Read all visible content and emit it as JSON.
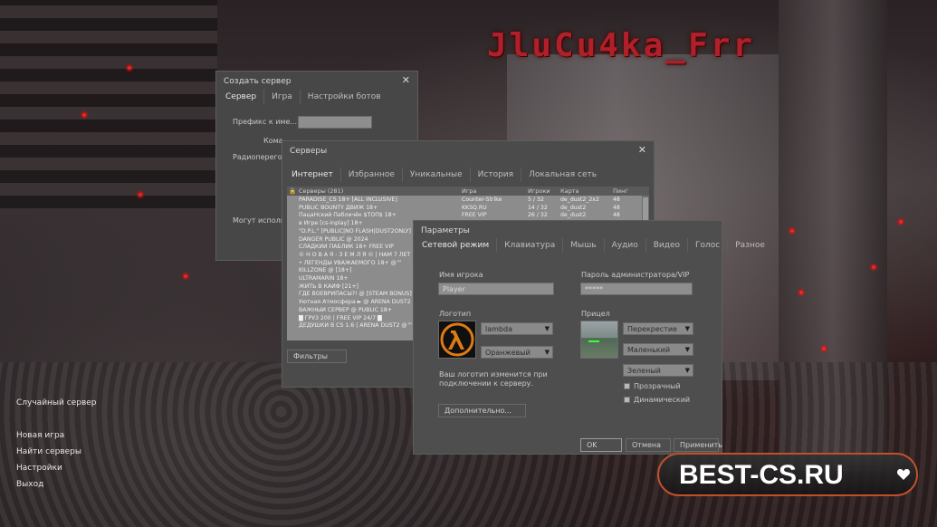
{
  "logo": {
    "text": "JluCu4ka_Frr"
  },
  "watermark": {
    "text": "BEST-CS.RU"
  },
  "menu": {
    "random_server": "Случайный сервер",
    "new_game": "Новая игра",
    "find_servers": "Найти серверы",
    "settings": "Настройки",
    "exit": "Выход"
  },
  "create_server": {
    "title": "Создать сервер",
    "tabs": [
      "Сервер",
      "Игра",
      "Настройки ботов"
    ],
    "prefix_label": "Префикс к име...",
    "team_label": "Кома...",
    "radio_label": "Радиопереговс...",
    "can_use_label": "Могут исполь..."
  },
  "servers": {
    "title": "Серверы",
    "tabs": [
      "Интернет",
      "Избранное",
      "Уникальные",
      "История",
      "Локальная сеть"
    ],
    "columns": [
      "Серверы (281)",
      "Игра",
      "Игроки",
      "Карта",
      "Пинг"
    ],
    "rows": [
      {
        "name": "PARADISE_CS 18+ [ALL INCLUSIVE]",
        "game": "Counter-Strike",
        "players": "5 / 32",
        "map": "de_dust2_2x2",
        "ping": "48"
      },
      {
        "name": "PUBLIC BOUNTY ДВИЖ 18+",
        "game": "KKSQ.RU",
        "players": "14 / 32",
        "map": "de_dust2",
        "ping": "48"
      },
      {
        "name": "ПацаНский Пабличёк $TOП$ 18+",
        "game": "FREE VIP",
        "players": "26 / 32",
        "map": "de_dust2",
        "ping": "48"
      },
      {
        "name": "в Игре [cs-inplay] 18+",
        "game": "",
        "players": "",
        "map": "",
        "ping": ""
      },
      {
        "name": "\"D.P.L.\" [PUBLIC|NO FLASH|DUST2ONLY]",
        "game": "",
        "players": "",
        "map": "",
        "ping": ""
      },
      {
        "name": "DANGER PUBLIC @ 2024",
        "game": "",
        "players": "",
        "map": "",
        "ping": ""
      },
      {
        "name": "СЛАДКИЙ ПАБЛИК 18+ FREE VIP",
        "game": "",
        "players": "",
        "map": "",
        "ping": ""
      },
      {
        "name": "© Н О В А Я - З Е М Л Я © | НАМ 7 ЛЕТ",
        "game": "",
        "players": "",
        "map": "",
        "ping": ""
      },
      {
        "name": "• ЛЕГЕНДЫ УВАЖАЕМОГО 18+ @™",
        "game": "",
        "players": "",
        "map": "",
        "ping": ""
      },
      {
        "name": "KILLZONE @ [18+]",
        "game": "",
        "players": "",
        "map": "",
        "ping": ""
      },
      {
        "name": "ULTRAMARIN 18+",
        "game": "",
        "players": "",
        "map": "",
        "ping": ""
      },
      {
        "name": "ЖИТЬ В КАЙФ [21+]",
        "game": "",
        "players": "",
        "map": "",
        "ping": ""
      },
      {
        "name": "ГДЕ ВОЕВРИПАСЫ?! @ [STEAM BONUS]",
        "game": "",
        "players": "",
        "map": "",
        "ping": ""
      },
      {
        "name": "Уютная Атмосфера ► @ ARENA DUST2",
        "game": "",
        "players": "",
        "map": "",
        "ping": ""
      },
      {
        "name": "ВАЖНЫЙ СЕРВЕР @ PUBLIC 18+",
        "game": "",
        "players": "",
        "map": "",
        "ping": ""
      },
      {
        "name": "█ ГРУЗ 200 | FREE VIP 24/7 █",
        "game": "",
        "players": "",
        "map": "",
        "ping": ""
      },
      {
        "name": "ДЕДУШКИ В CS 1.6 | ARENA DUST2 @™",
        "game": "",
        "players": "",
        "map": "",
        "ping": ""
      }
    ],
    "filters_button": "Фильтры"
  },
  "params": {
    "title": "Параметры",
    "tabs": [
      "Сетевой режим",
      "Клавиатура",
      "Мышь",
      "Аудио",
      "Видео",
      "Голос",
      "Разное"
    ],
    "player_name_label": "Имя игрока",
    "player_name_value": "Player",
    "admin_pass_label": "Пароль администратора/VIP",
    "admin_pass_value": "*****",
    "logo_label": "Логотип",
    "logo_value": "lambda",
    "logo_color": "Оранжевый",
    "crosshair_label": "Прицел",
    "crosshair_style": "Перекрестие",
    "crosshair_size": "Маленький",
    "crosshair_color": "Зеленый",
    "translucent_label": "Прозрачный",
    "dynamic_label": "Динамический",
    "logo_note": "Ваш логотип изменится при подключении к серверу.",
    "advanced_button": "Дополнительно...",
    "ok_button": "OK",
    "cancel_button": "Отмена",
    "apply_button": "Применить"
  },
  "colors": {
    "logo_red": "#b0202a",
    "lambda_orange": "#e07b14",
    "watermark_border": "#c0502c"
  }
}
